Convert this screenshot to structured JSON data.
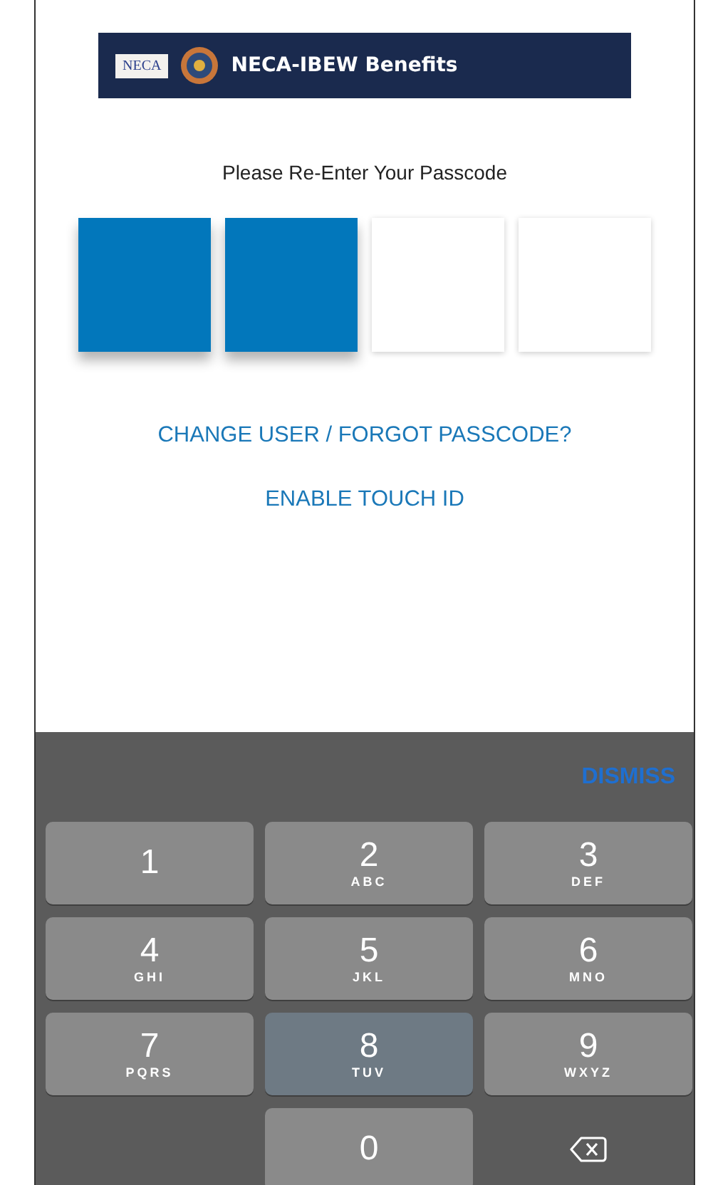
{
  "banner": {
    "badge": "NECA",
    "title": "NECA-IBEW Benefits"
  },
  "prompt": "Please Re-Enter Your Passcode",
  "passcode": [
    {
      "filled": true
    },
    {
      "filled": true
    },
    {
      "filled": false
    },
    {
      "filled": false
    }
  ],
  "links": [
    "CHANGE USER / FORGOT PASSCODE?",
    "ENABLE TOUCH ID"
  ],
  "keyboard": {
    "dismiss": "DISMISS",
    "keys": [
      {
        "kind": "digit",
        "digit": "1",
        "pressed": false
      },
      {
        "kind": "digit",
        "digit": "2",
        "letters": "ABC",
        "pressed": false
      },
      {
        "kind": "digit",
        "digit": "3",
        "letters": "DEF",
        "pressed": false
      },
      {
        "kind": "digit",
        "digit": "4",
        "letters": "GHI",
        "pressed": false
      },
      {
        "kind": "digit",
        "digit": "5",
        "letters": "JKL",
        "pressed": false
      },
      {
        "kind": "digit",
        "digit": "6",
        "letters": "MNO",
        "pressed": false
      },
      {
        "kind": "digit",
        "digit": "7",
        "letters": "PQRS",
        "pressed": false
      },
      {
        "kind": "digit",
        "digit": "8",
        "letters": "TUV",
        "pressed": true
      },
      {
        "kind": "digit",
        "digit": "9",
        "letters": "WXYZ",
        "pressed": false
      },
      {
        "kind": "blank"
      },
      {
        "kind": "digit",
        "digit": "0",
        "pressed": false
      },
      {
        "kind": "backspace"
      }
    ]
  }
}
